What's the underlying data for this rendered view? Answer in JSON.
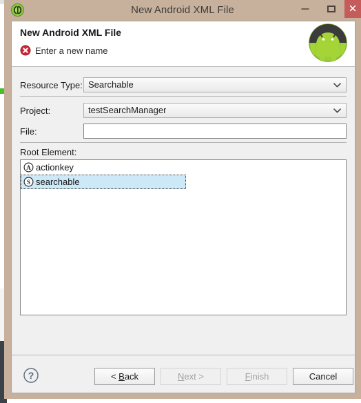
{
  "window": {
    "title": "New Android XML File",
    "app_icon": "eclipse-icon",
    "controls": {
      "minimize": "minimize-icon",
      "maximize": "maximize-icon",
      "close": "✕"
    }
  },
  "header": {
    "title": "New Android XML File",
    "message": "Enter a new name",
    "status_icon": "error-icon",
    "brand_icon": "android-logo",
    "error_color": "#cc2936"
  },
  "form": {
    "resource_type": {
      "label": "Resource Type:",
      "value": "Searchable",
      "chevron": "chevron-down-icon"
    },
    "project": {
      "label": "Project:",
      "value": "testSearchManager",
      "chevron": "chevron-down-icon"
    },
    "file": {
      "label": "File:",
      "value": "",
      "placeholder": ""
    }
  },
  "root_element": {
    "label": "Root Element:",
    "items": [
      {
        "label": "actionkey",
        "icon_letter": "A",
        "selected": false
      },
      {
        "label": "searchable",
        "icon_letter": "S",
        "selected": true
      }
    ],
    "selection_color": "#cde8f6"
  },
  "buttons": {
    "help": "help-icon",
    "back": {
      "prefix": "< ",
      "mnemonic": "B",
      "rest": "ack",
      "enabled": true
    },
    "next": {
      "prefix": "",
      "mnemonic": "N",
      "rest": "ext >",
      "enabled": false
    },
    "finish": {
      "prefix": "",
      "mnemonic": "F",
      "rest": "inish",
      "enabled": false
    },
    "cancel": {
      "prefix": "",
      "mnemonic": "",
      "rest": "Cancel",
      "enabled": true
    }
  }
}
